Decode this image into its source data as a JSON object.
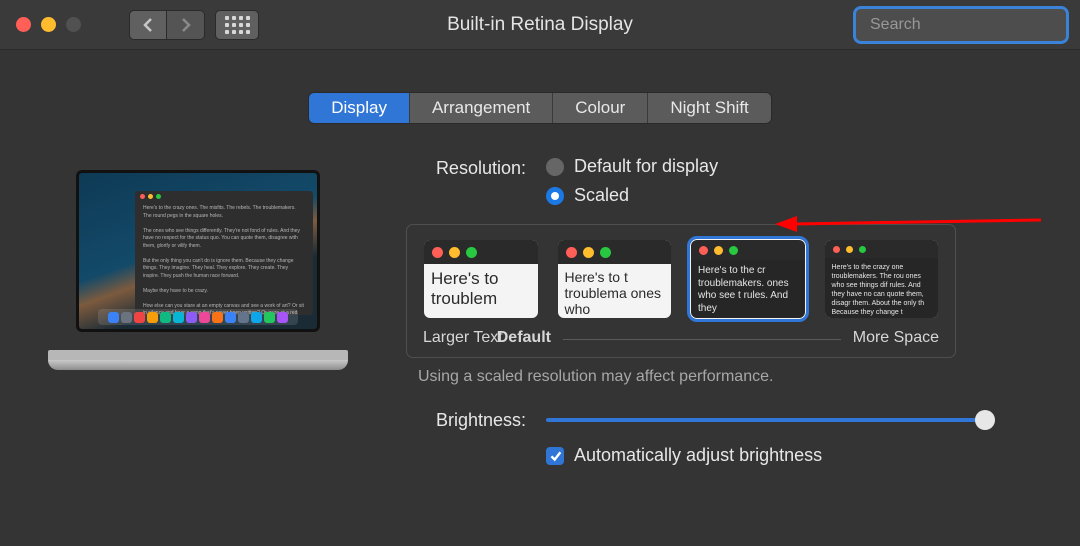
{
  "window": {
    "title": "Built-in Retina Display",
    "search_placeholder": "Search"
  },
  "tabs": [
    {
      "label": "Display",
      "active": true
    },
    {
      "label": "Arrangement",
      "active": false
    },
    {
      "label": "Colour",
      "active": false
    },
    {
      "label": "Night Shift",
      "active": false
    }
  ],
  "resolution": {
    "label": "Resolution:",
    "options": [
      {
        "label": "Default for display",
        "selected": false
      },
      {
        "label": "Scaled",
        "selected": true
      }
    ],
    "thumb_text_short": "Here's to troublem",
    "thumb_text_med": "Here's to t troublema ones who",
    "thumb_text_sel": "Here's to the cr troublemakers. ones who see t rules. And they",
    "thumb_text_tiny": "Here's to the crazy one troublemakers. The rou ones who see things dif rules. And they have no can quote them, disagr them. About the only th Because they change t",
    "scale_left": "Larger Text",
    "scale_mid": "Default",
    "scale_right": "More Space",
    "hint": "Using a scaled resolution may affect performance."
  },
  "brightness": {
    "label": "Brightness:",
    "auto_label": "Automatically adjust brightness",
    "value_percent": 100
  }
}
